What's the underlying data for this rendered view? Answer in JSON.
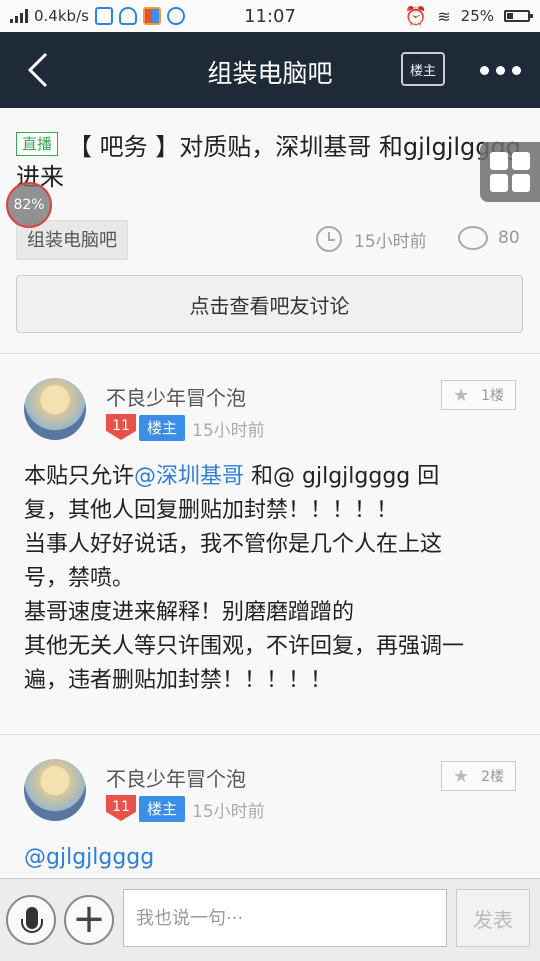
{
  "status_bar": {
    "net_speed": "0.4kb/s",
    "time": "11:07",
    "battery": "25%",
    "battery_level": 0.25
  },
  "header": {
    "title": "组装电脑吧",
    "louzhu_button": "楼主",
    "back_icon": "chevron-left-icon",
    "more_icon": "more-dots-icon"
  },
  "post": {
    "live_tag": "直播",
    "title_line1": "【 吧务 】对质贴，深圳基哥 和gjlgjlgggg",
    "title_line2": "进来",
    "progress": "82%",
    "forum_tag": "组装电脑吧",
    "time": "15小时前",
    "comment_count": "80",
    "view_discussion": "点击查看吧友讨论"
  },
  "floors": [
    {
      "username": "不良少年冒个泡",
      "level": "11",
      "lz_tag": "楼主",
      "time": "15小时前",
      "floor_label": "1楼",
      "body_prefix": "本贴只允许",
      "body_mention": "@深圳基哥",
      "body_rest_line1": " 和@ gjlgjlgggg 回",
      "body_line2": "复，其他人回复删贴加封禁！！！！！",
      "body_line3": "当事人好好说话，我不管你是几个人在上这",
      "body_line4": "号，禁喷。",
      "body_line5": "基哥速度进来解释！别磨磨蹭蹭的",
      "body_line6": "其他无关人等只许围观，不许回复，再强调一",
      "body_line7": "遍，违者删贴加封禁！！！！！"
    },
    {
      "username": "不良少年冒个泡",
      "level": "11",
      "lz_tag": "楼主",
      "time": "15小时前",
      "floor_label": "2楼",
      "body_mention": "@gjlgjlgggg"
    }
  ],
  "input_bar": {
    "placeholder": "我也说一句···",
    "send_label": "发表"
  }
}
